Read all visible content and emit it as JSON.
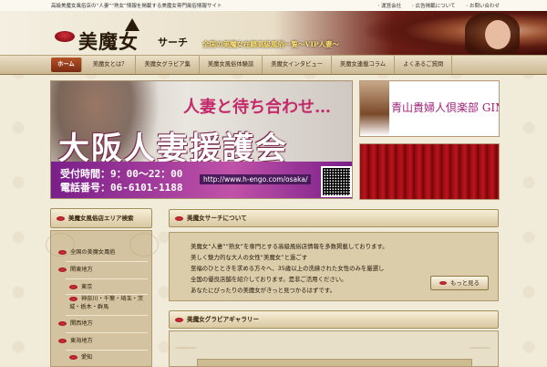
{
  "topbar": {
    "tagline": "高級美魔女風俗店の“人妻”“熟女”情報を掲載する美魔女専門風俗情報サイト",
    "links": [
      "運営会社",
      "広告掲載について",
      "お問い合わせ"
    ]
  },
  "header": {
    "logo_main": "美魔女",
    "logo_sub": "サーチ",
    "slogan": "全国の美魔女在籍高級風俗一覧〜VIP人妻〜"
  },
  "nav": {
    "home": "ホーム",
    "items": [
      "美魔女とは？",
      "美魔女グラビア集",
      "美魔女風俗体験談",
      "美魔女インタビュー",
      "美魔女連載コラム",
      "よくあるご質問"
    ]
  },
  "banner_main": {
    "title1": "人妻と待ち合わせ…",
    "title2": "大阪人妻援護会",
    "hours": "受付時間：9：00〜22：00",
    "tel": "電話番号：06-6101-1188",
    "url": "http://www.h-engo.com/osaka/"
  },
  "banner_gimlet": {
    "text": "青山貴婦人倶楽部 GIMLET"
  },
  "sidebar": {
    "heading": "美魔女風俗店エリア検索",
    "items": [
      {
        "label": "全国の美魔女風俗",
        "level": 1
      },
      {
        "label": "関東地方",
        "level": 1
      },
      {
        "label": "東京",
        "level": 2
      },
      {
        "label": "神奈川・千葉・埼玉・茨城・栃木・群馬",
        "level": 2
      },
      {
        "label": "関西地方",
        "level": 1
      },
      {
        "label": "東海地方",
        "level": 1
      },
      {
        "label": "愛知",
        "level": 2
      }
    ]
  },
  "main": {
    "intro_heading": "美魔女サーチについて",
    "intro_lines": [
      "美魔女“人妻”“熟女”を専門とする高級風俗店情報を多数掲載しております。",
      "美しく魅力的な大人の女性“美魔女”と過ごす",
      "至福のひとときを求める方々へ、35歳以上の洗練された女性のみを厳選し",
      "全国の優良店舗を紹介しております。是非ご活用ください。",
      "あなたにぴったりの美魔女がきっと見つかるはずです。"
    ],
    "more_button": "もっと見る",
    "gravure_heading": "美魔女グラビアギャラリー"
  }
}
